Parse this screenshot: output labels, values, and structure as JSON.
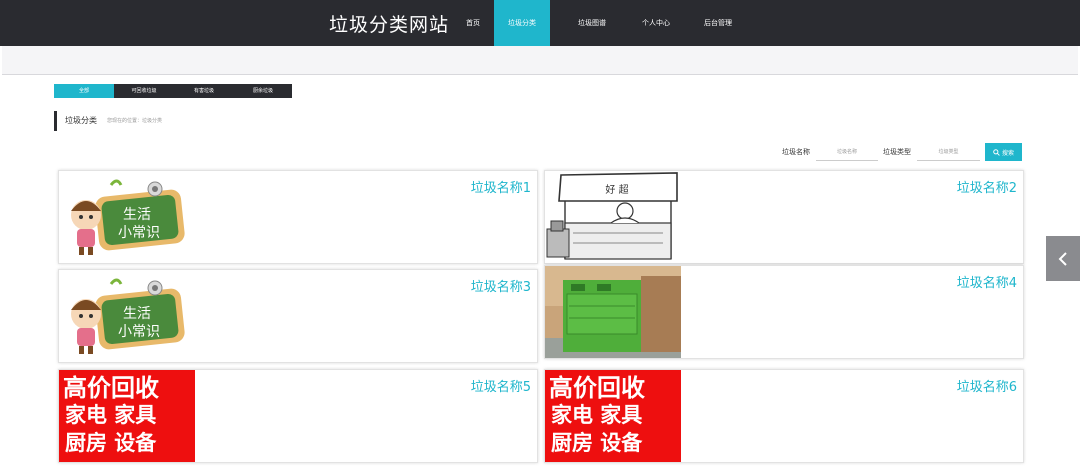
{
  "header": {
    "site_title": "垃圾分类网站",
    "nav": [
      {
        "label": "首页",
        "active": false
      },
      {
        "label": "垃圾分类",
        "active": true
      },
      {
        "label": "垃圾图谱",
        "active": false
      },
      {
        "label": "个人中心",
        "active": false
      },
      {
        "label": "后台管理",
        "active": false
      }
    ]
  },
  "category_tabs": [
    {
      "label": "全部",
      "active": true
    },
    {
      "label": "可回收垃圾",
      "active": false
    },
    {
      "label": "有害垃圾",
      "active": false
    },
    {
      "label": "厨余垃圾",
      "active": false
    }
  ],
  "section": {
    "title": "垃圾分类",
    "breadcrumb": "您现在的位置：垃圾分类"
  },
  "search": {
    "name_label": "垃圾名称",
    "name_placeholder": "垃圾名称",
    "type_label": "垃圾类型",
    "type_placeholder": "垃圾类型",
    "button_label": "搜索"
  },
  "cards": [
    {
      "name": "垃圾名称1",
      "image": "life-tips-cartoon-image"
    },
    {
      "name": "垃圾名称2",
      "image": "shop-sketch-image"
    },
    {
      "name": "垃圾名称3",
      "image": "life-tips-cartoon-image"
    },
    {
      "name": "垃圾名称4",
      "image": "green-recycling-bin-photo"
    },
    {
      "name": "垃圾名称5",
      "image": "recycle-ad-banner-image"
    },
    {
      "name": "垃圾名称6",
      "image": "recycle-ad-banner-image"
    }
  ],
  "image_text": {
    "life_tips_line1": "生活",
    "life_tips_line2": "小常识",
    "shop_sign": "好 超",
    "banner_line1": "高价回收",
    "banner_line2": "家电 家具",
    "banner_line3": "厨房 设备"
  },
  "colors": {
    "accent": "#1fb6cc",
    "dark": "#2a2b30"
  },
  "icons": {
    "search": "search-icon",
    "side": "chevron-left-icon"
  }
}
